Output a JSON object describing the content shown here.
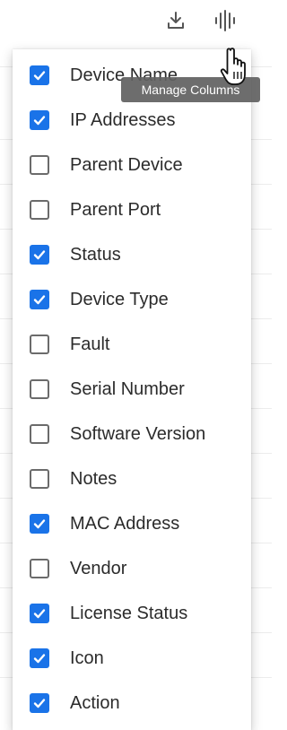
{
  "toolbar": {
    "download_icon": "download-icon",
    "columns_icon": "columns-icon"
  },
  "tooltip": {
    "text": "Manage Columns"
  },
  "colors": {
    "checkbox_checked": "#1a73e8",
    "checkbox_border": "#6b6b6b",
    "tooltip_bg": "#616161"
  },
  "menu": {
    "items": [
      {
        "label": "Device Name",
        "checked": true
      },
      {
        "label": "IP Addresses",
        "checked": true
      },
      {
        "label": "Parent Device",
        "checked": false
      },
      {
        "label": "Parent Port",
        "checked": false
      },
      {
        "label": "Status",
        "checked": true
      },
      {
        "label": "Device Type",
        "checked": true
      },
      {
        "label": "Fault",
        "checked": false
      },
      {
        "label": "Serial Number",
        "checked": false
      },
      {
        "label": "Software Version",
        "checked": false
      },
      {
        "label": "Notes",
        "checked": false
      },
      {
        "label": "MAC Address",
        "checked": true
      },
      {
        "label": "Vendor",
        "checked": false
      },
      {
        "label": "License Status",
        "checked": true
      },
      {
        "label": "Icon",
        "checked": true
      },
      {
        "label": "Action",
        "checked": true
      }
    ]
  }
}
